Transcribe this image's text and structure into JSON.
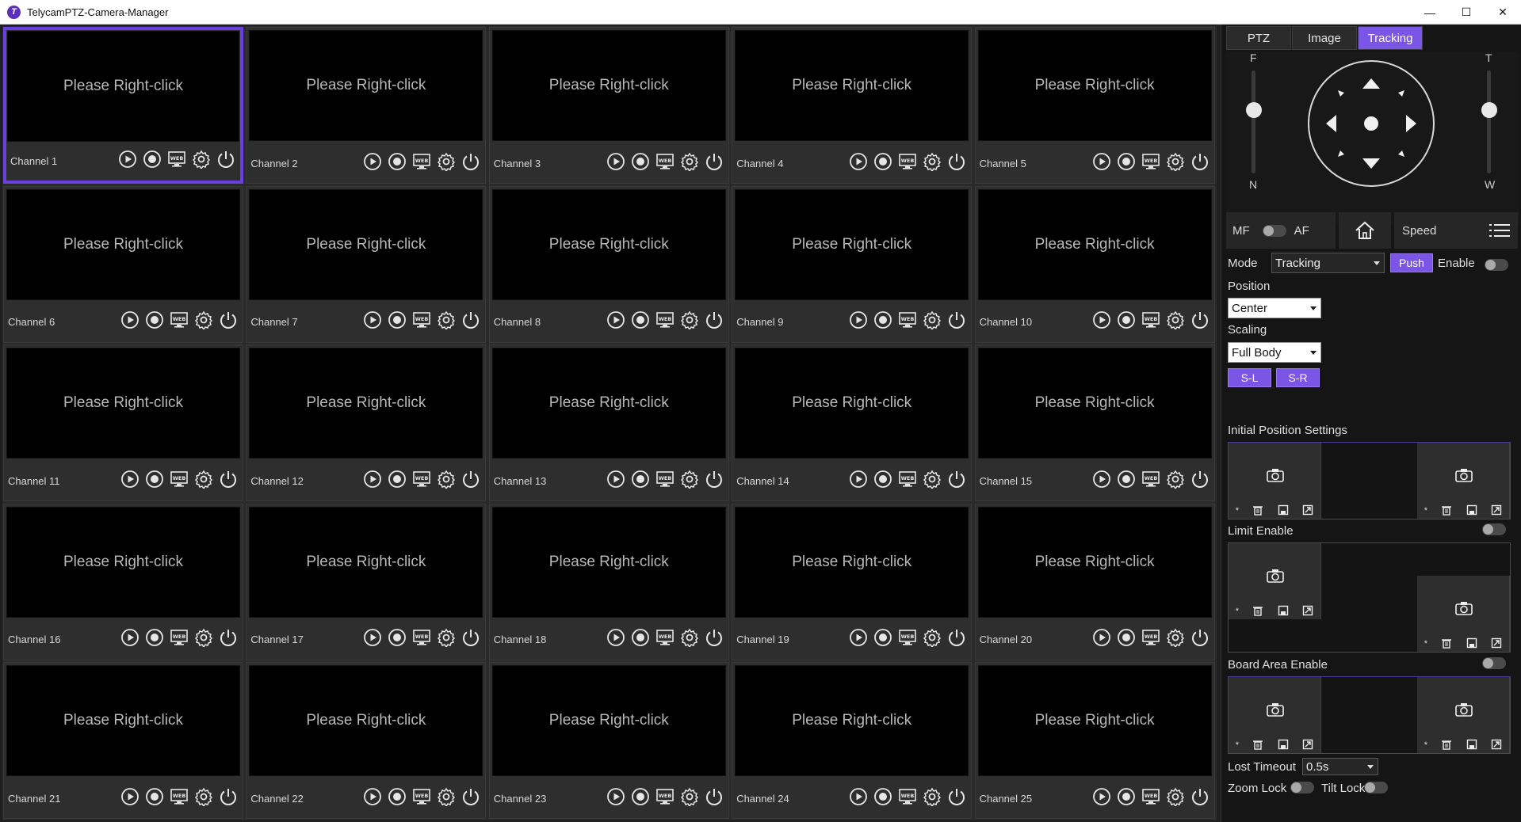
{
  "window": {
    "title": "TelycamPTZ-Camera-Manager",
    "app_icon": "T",
    "minimize": "—",
    "maximize": "☐",
    "close": "✕"
  },
  "grid": {
    "placeholder": "Please Right-click",
    "channels": [
      "Channel 1",
      "Channel 2",
      "Channel 3",
      "Channel 4",
      "Channel 5",
      "Channel 6",
      "Channel 7",
      "Channel 8",
      "Channel 9",
      "Channel 10",
      "Channel 11",
      "Channel 12",
      "Channel 13",
      "Channel 14",
      "Channel 15",
      "Channel 16",
      "Channel 17",
      "Channel 18",
      "Channel 19",
      "Channel 20",
      "Channel 21",
      "Channel 22",
      "Channel 23",
      "Channel 24",
      "Channel 25"
    ],
    "selected_channel": "Channel 1",
    "cell_icons": [
      "play-icon",
      "record-icon",
      "web-icon",
      "settings-icon",
      "power-icon"
    ],
    "web_text": "WEB"
  },
  "panel": {
    "tabs": [
      "PTZ",
      "Image",
      "Tracking"
    ],
    "active_tab": "Tracking",
    "focus_top": "F",
    "focus_bottom": "N",
    "zoom_top": "T",
    "zoom_bottom": "W",
    "mf_label": "MF",
    "af_label": "AF",
    "speed_label": "Speed",
    "mode_label": "Mode",
    "mode_value": "Tracking",
    "push_label": "Push",
    "enable_label": "Enable",
    "position_label": "Position",
    "position_value": "Center",
    "scaling_label": "Scaling",
    "scaling_value": "Full Body",
    "sl_label": "S-L",
    "sr_label": "S-R",
    "initial_position_label": "Initial Position Settings",
    "limit_enable_label": "Limit Enable",
    "board_area_label": "Board Area Enable",
    "lost_timeout_label": "Lost Timeout",
    "lost_timeout_value": "0.5s",
    "zoom_lock_label": "Zoom Lock",
    "tilt_lock_label": "Tilt Lock",
    "preset_star": "*"
  },
  "colors": {
    "accent": "#7b55e6",
    "selected_border": "#6a3fe0",
    "panel_bg": "#151515",
    "video_bg": "#000000"
  }
}
